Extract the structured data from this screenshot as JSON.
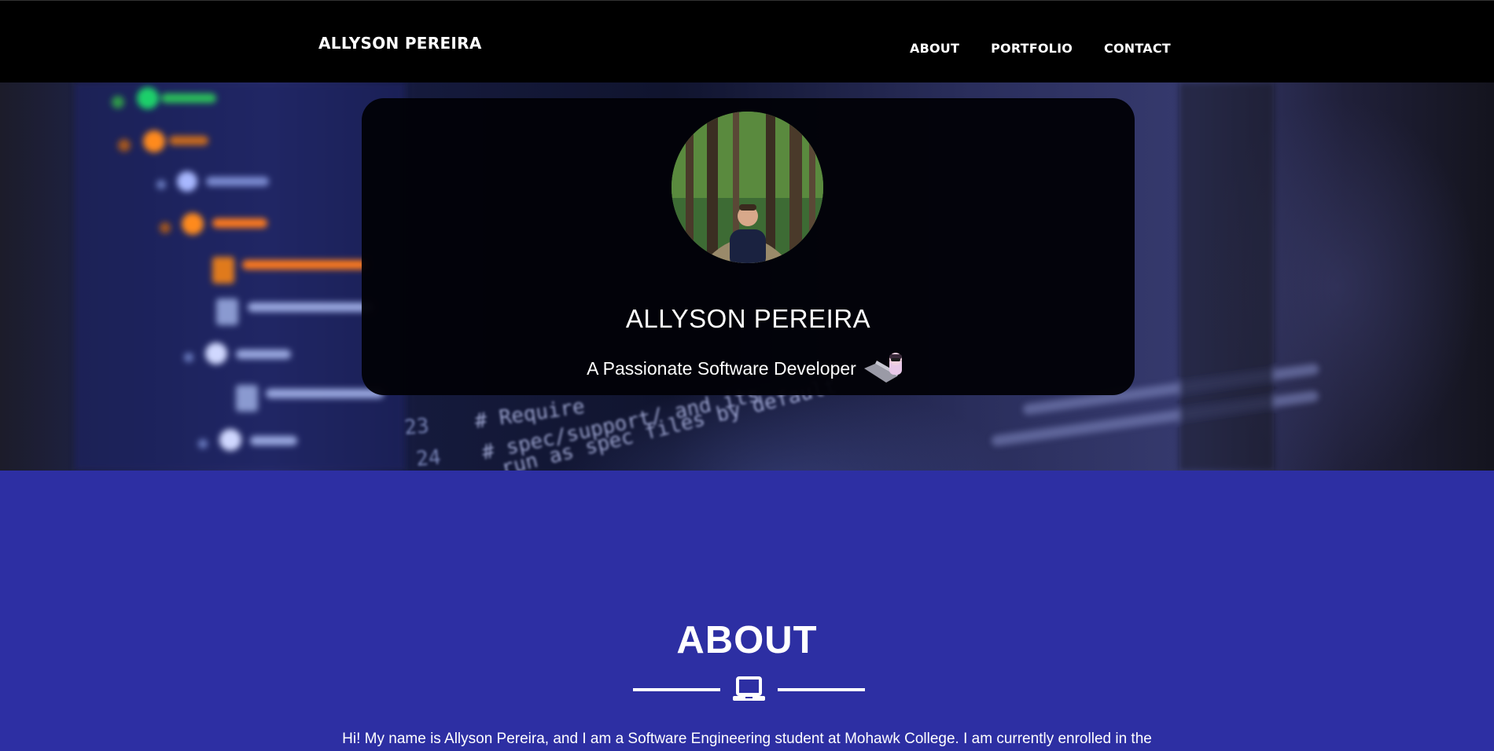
{
  "navbar": {
    "brand": "ALLYSON PEREIRA",
    "links": [
      "ABOUT",
      "PORTFOLIO",
      "CONTACT"
    ]
  },
  "hero": {
    "name": "ALLYSON PEREIRA",
    "tagline": "A Passionate Software Developer",
    "tagline_icon": "developer-laptop-emoji",
    "avatar_icon": "profile-photo-forest"
  },
  "about": {
    "title": "ABOUT",
    "divider_icon": "laptop-icon",
    "text": "Hi! My name is Allyson Pereira, and I am a Software Engineering student at Mohawk College. I am currently enrolled in the"
  },
  "colors": {
    "navbar_bg": "#000000",
    "about_bg": "#2d2fa3",
    "card_bg": "#020208",
    "text": "#ffffff"
  }
}
